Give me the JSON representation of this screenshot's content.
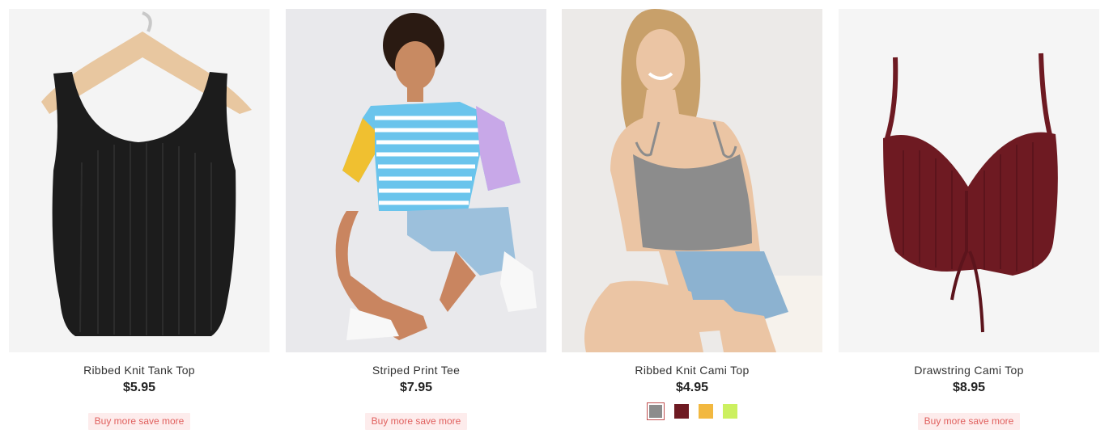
{
  "products": [
    {
      "name": "Ribbed Knit Tank Top",
      "price": "$5.95",
      "promo": "Buy more save more",
      "image_desc": "black ribbed tank top on hanger"
    },
    {
      "name": "Striped Print Tee",
      "price": "$7.95",
      "promo": "Buy more save more",
      "image_desc": "model in striped color-block tee"
    },
    {
      "name": "Ribbed Knit Cami Top",
      "price": "$4.95",
      "swatches": [
        {
          "color": "#8c8c8c",
          "selected": true
        },
        {
          "color": "#6e1a22",
          "selected": false
        },
        {
          "color": "#f2b840",
          "selected": false
        },
        {
          "color": "#ccf060",
          "selected": false
        }
      ],
      "image_desc": "model in grey cami top"
    },
    {
      "name": "Drawstring Cami Top",
      "price": "$8.95",
      "promo": "Buy more save more",
      "image_desc": "burgundy drawstring cami top"
    }
  ],
  "colors": {
    "promo_bg": "#fdecec",
    "promo_text": "#e0605e",
    "black_top": "#1c1c1c",
    "burgundy_top": "#6e1a22",
    "grey_top": "#8c8c8c"
  }
}
